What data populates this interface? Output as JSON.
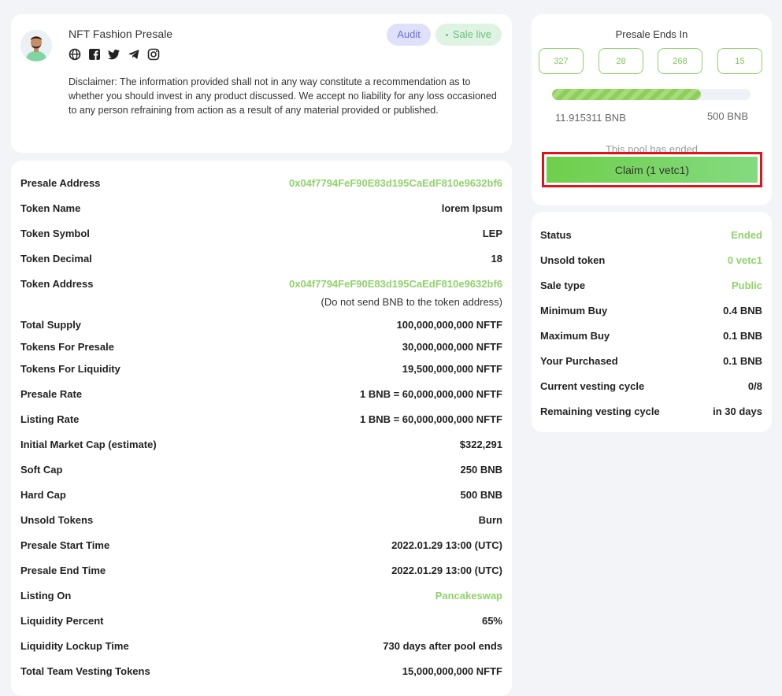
{
  "header": {
    "project_name": "NFT Fashion Presale",
    "badge_audit": "Audit",
    "badge_live": "Sale live",
    "disclaimer": "Disclaimer: The information provided shall not in any way constitute a recommendation as to whether you should invest in any product discussed. We accept no liability for any loss occasioned to any person refraining from action as a result of any material provided or published.",
    "socials": [
      "globe-icon",
      "facebook-icon",
      "twitter-icon",
      "telegram-icon",
      "instagram-icon"
    ]
  },
  "details": {
    "rows": [
      {
        "label": "Presale Address",
        "value": "0x04f7794FeF90E83d195CaEdF810e9632bf6"
      },
      {
        "label": "Token Name",
        "value": "lorem Ipsum"
      },
      {
        "label": "Token Symbol",
        "value": "LEP"
      },
      {
        "label": "Token Decimal",
        "value": "18"
      },
      {
        "label": "Token Address",
        "value": "0x04f7794FeF90E83d195CaEdF810e9632bf6"
      },
      {
        "label": "Total Supply",
        "value": "100,000,000,000 NFTF"
      },
      {
        "label": "Tokens For Presale",
        "value": "30,000,000,000 NFTF"
      },
      {
        "label": "Tokens For Liquidity",
        "value": "19,500,000,000 NFTF"
      },
      {
        "label": "Presale Rate",
        "value": "1 BNB = 60,000,000,000 NFTF"
      },
      {
        "label": "Listing Rate",
        "value": "1 BNB = 60,000,000,000 NFTF"
      },
      {
        "label": "Initial Market Cap (estimate)",
        "value": "$322,291"
      },
      {
        "label": "Soft Cap",
        "value": "250 BNB"
      },
      {
        "label": "Hard Cap",
        "value": "500 BNB"
      },
      {
        "label": "Unsold Tokens",
        "value": "Burn"
      },
      {
        "label": "Presale Start Time",
        "value": "2022.01.29 13:00 (UTC)"
      },
      {
        "label": "Presale End Time",
        "value": "2022.01.29 13:00 (UTC)"
      },
      {
        "label": "Listing On",
        "value": "Pancakeswap"
      },
      {
        "label": "Liquidity Percent",
        "value": "65%"
      },
      {
        "label": "Liquidity Lockup Time",
        "value": "730 days after pool ends"
      },
      {
        "label": "Total Team Vesting Tokens",
        "value": "15,000,000,000 NFTF"
      }
    ],
    "token_address_note": "(Do not send BNB to the token address)"
  },
  "timer": {
    "title": "Presale Ends In",
    "counts": [
      "327",
      "28",
      "268",
      "15"
    ],
    "progress_fraction": 0.75,
    "raised": "11.915311 BNB",
    "cap": "500 BNB",
    "ended_text": "This pool has ended",
    "claim_label": "Claim (1 vetc1)"
  },
  "status": {
    "rows": [
      {
        "label": "Status",
        "value": "Ended"
      },
      {
        "label": "Unsold token",
        "value": "0 vetc1"
      },
      {
        "label": "Sale type",
        "value": "Public"
      },
      {
        "label": "Minimum Buy",
        "value": "0.4 BNB"
      },
      {
        "label": "Maximum Buy",
        "value": "0.1 BNB"
      },
      {
        "label": "Your Purchased",
        "value": "0.1 BNB"
      },
      {
        "label": "Current vesting cycle",
        "value": "0/8"
      },
      {
        "label": "Remaining vesting cycle",
        "value": "in 30 days"
      }
    ]
  },
  "colors": {
    "accent_green": "#8fd36b",
    "audit_purple": "#6b6fe0",
    "highlight_red": "#e0141c"
  }
}
